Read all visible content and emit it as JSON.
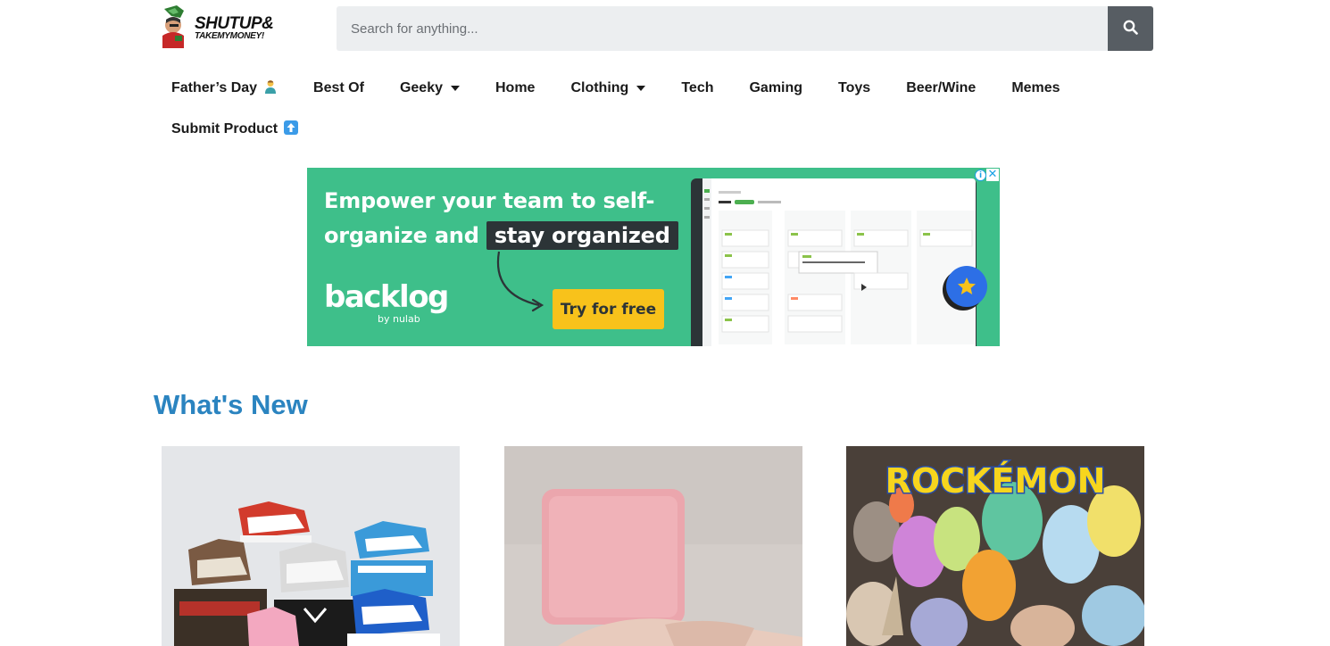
{
  "header": {
    "logo": {
      "line1": "SHUTUP&",
      "line2": "TAKEMYMONEY!"
    },
    "search": {
      "placeholder": "Search for anything...",
      "value": ""
    }
  },
  "nav": {
    "items": [
      {
        "label": "Father’s Day",
        "emoji": "🙎",
        "has_dropdown": false
      },
      {
        "label": "Best Of",
        "has_dropdown": false
      },
      {
        "label": "Geeky",
        "has_dropdown": true
      },
      {
        "label": "Home",
        "has_dropdown": false
      },
      {
        "label": "Clothing",
        "has_dropdown": true
      },
      {
        "label": "Tech",
        "has_dropdown": false
      },
      {
        "label": "Gaming",
        "has_dropdown": false
      },
      {
        "label": "Toys",
        "has_dropdown": false
      },
      {
        "label": "Beer/Wine",
        "has_dropdown": false
      },
      {
        "label": "Memes",
        "has_dropdown": false
      },
      {
        "label": "Submit Product",
        "emoji": "⬆️",
        "has_dropdown": false
      }
    ]
  },
  "ad": {
    "headline_part1": "Empower your team to self-",
    "headline_part2": "organize and",
    "headline_highlight": "stay organized",
    "brand": "backlog",
    "brand_sub": "by nulab",
    "cta": "Try for free",
    "info_glyph": "i",
    "close_glyph": "✕",
    "colors": {
      "background": "#3ebf8a",
      "cta": "#f8c21b",
      "highlight": "#2c3437"
    }
  },
  "main": {
    "section_title": "What's New",
    "cards": [
      {
        "image": "sneaker airpod cases"
      },
      {
        "image": "pink block"
      },
      {
        "image": "rockemon figures",
        "caption_art": "ROCKÉMON"
      }
    ]
  },
  "colors": {
    "accent": "#2b84c0",
    "search_button": "#575d63"
  }
}
